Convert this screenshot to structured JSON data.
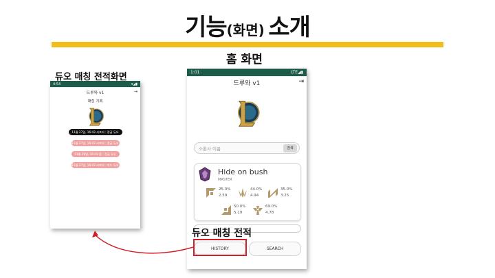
{
  "slide": {
    "title_main": "기능",
    "title_paren": "(화면)",
    "title_end": "소개",
    "accent_color": "#f2bd1c"
  },
  "labels": {
    "home_screen": "홈 화면",
    "duo_screen": "듀오 매칭 전적화면",
    "duo_callout": "듀오 매칭 전적"
  },
  "phone_small": {
    "status_time": "4:54",
    "status_right": "▾◢▮",
    "app_title": "드루와 v1",
    "subtitle": "매칭 기록",
    "logo_icon": "league-of-legends-logo",
    "history": [
      {
        "text": "11월 27일, 16:43 시프터 : 정글 듀오",
        "style": "dark"
      },
      {
        "text": "11월 27일, 16:43 시프터 : 정글 듀오",
        "style": "pink"
      },
      {
        "text": "11월 28일, 16:43 할 : 정글 듀오",
        "style": "pink"
      },
      {
        "text": "11월 27일, 16:43 시프터 : 미드 듀오",
        "style": "pink"
      }
    ]
  },
  "phone_big": {
    "status_time": "1:01",
    "status_right": "LTE◢▮",
    "app_title": "드루와 v1",
    "logo_icon": "league-of-legends-logo",
    "search_placeholder": "소환사 이름",
    "search_button": "검색",
    "profile": {
      "summoner": "Hide on bush",
      "tier": "MASTER",
      "positions": [
        {
          "icon": "top-lane-icon",
          "winrate": "25.0%",
          "kda": "2.59"
        },
        {
          "icon": "jungle-icon",
          "winrate": "44.0%",
          "kda": "4.94"
        },
        {
          "icon": "mid-lane-icon",
          "winrate": "35.0%",
          "kda": "3.25"
        },
        {
          "icon": "bottom-lane-icon",
          "winrate": "50.0%",
          "kda": "5.19"
        },
        {
          "icon": "support-icon",
          "winrate": "69.0%",
          "kda": "4.78"
        }
      ]
    },
    "history_button": "HISTORY",
    "search_nav_button": "SEARCH"
  },
  "annotation": {
    "highlight_color": "#d01f28"
  }
}
